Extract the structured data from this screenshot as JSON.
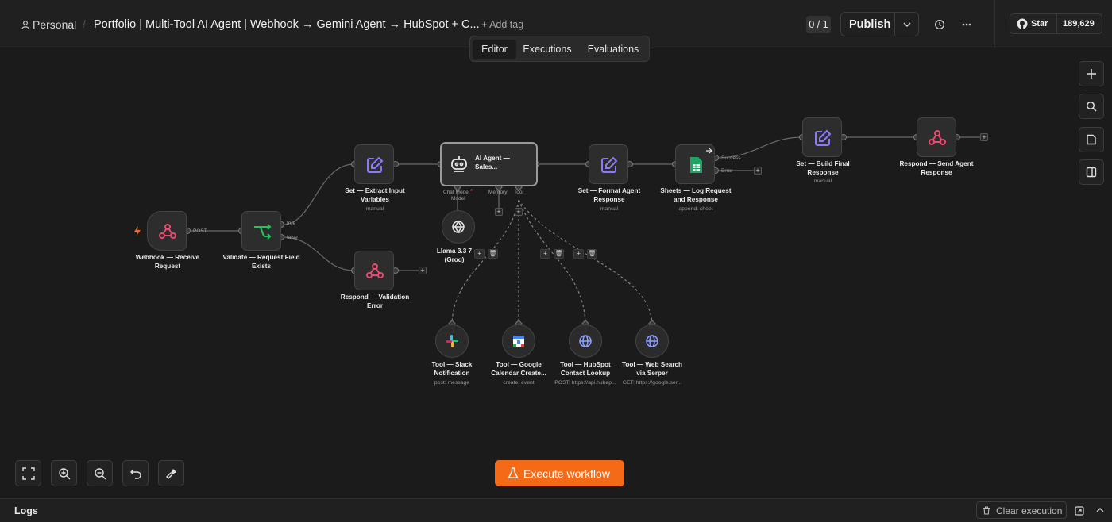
{
  "header": {
    "project": "Personal",
    "title": "Portfolio | Multi-Tool AI Agent | Webhook → Gemini Agent → HubSpot + C...",
    "add_tag": "+ Add tag",
    "counter": "0 / 1",
    "publish": "Publish",
    "star_label": "Star",
    "star_count": "189,629"
  },
  "tabs": [
    "Editor",
    "Executions",
    "Evaluations"
  ],
  "nodes": {
    "webhook": {
      "label1": "Webhook — Receive",
      "label2": "Request"
    },
    "validate": {
      "label1": "Validate — Request Field",
      "label2": "Exists"
    },
    "extract": {
      "label1": "Set — Extract Input",
      "label2": "Variables",
      "sub": "manual"
    },
    "respond_err": {
      "label1": "Respond — Validation",
      "label2": "Error"
    },
    "agent": {
      "line1": "AI Agent —",
      "line2": "Sales..."
    },
    "llama": {
      "label1": "Llama 3.3 7",
      "label2": "(Groq)"
    },
    "format": {
      "label1": "Set — Format Agent",
      "label2": "Response",
      "sub": "manual"
    },
    "sheets": {
      "label1": "Sheets — Log Request",
      "label2": "and Response",
      "sub": "append: sheet"
    },
    "final": {
      "label1": "Set — Build Final",
      "label2": "Response",
      "sub": "manual"
    },
    "respond_send": {
      "label1": "Respond — Send Agent",
      "label2": "Response"
    },
    "slack": {
      "label1": "Tool — Slack",
      "label2": "Notification",
      "sub": "post: message"
    },
    "calendar": {
      "label1": "Tool — Google",
      "label2": "Calendar Create...",
      "sub": "create: event"
    },
    "hubspot": {
      "label1": "Tool — HubSpot",
      "label2": "Contact Lookup",
      "sub": "POST: https://api.hubap..."
    },
    "serper": {
      "label1": "Tool — Web Search",
      "label2": "via Serper",
      "sub": "GET: https://google.ser..."
    }
  },
  "port_labels": {
    "post": "POST",
    "true": "true",
    "false": "false",
    "chat_model": "Chat Model",
    "chat_model_sub": "Model",
    "memory": "Memory",
    "tool": "Tool",
    "success": "Success",
    "error": "Error"
  },
  "execute": "Execute workflow",
  "logs": {
    "title": "Logs",
    "clear": "Clear execution"
  },
  "colors": {
    "accent": "#f56a17",
    "webhook_icon": "#ea4b71",
    "edit_icon": "#8b7cf6",
    "sheets": "#1fa463",
    "validate_icon": "#22c55e"
  }
}
